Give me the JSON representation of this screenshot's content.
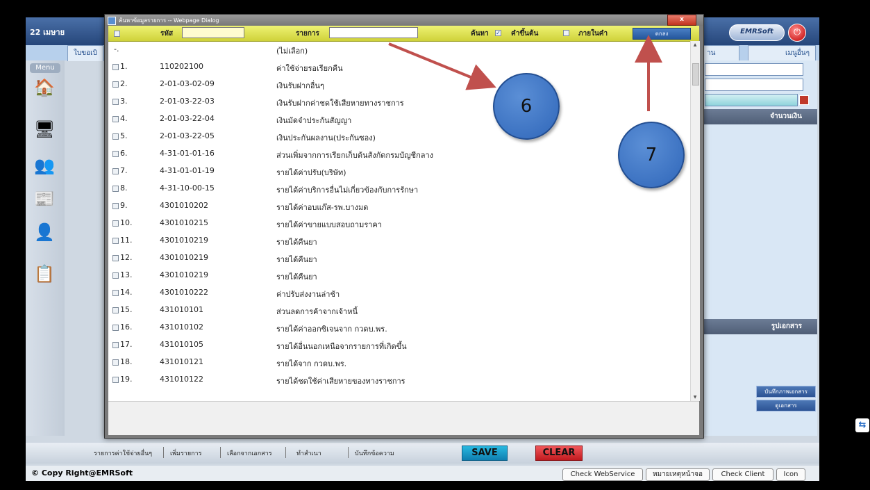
{
  "app": {
    "date_text": "22 เมษาย",
    "logo_text": "EMRSoft",
    "power_icon": "power-icon",
    "tabs": [
      {
        "label": "ใบขอเบิ"
      },
      {
        "label": "าน"
      },
      {
        "label": "เมนูอื่นๆ"
      }
    ],
    "menu_label": "Menu",
    "menu_icons": [
      "home-icon",
      "computer-key-icon",
      "users-icon",
      "documents-icon",
      "user-settings-icon",
      "clipboard-icon"
    ],
    "right_panel": {
      "amount_header": "จำนวนเงิน",
      "doc_header": "รูปเอกสาร",
      "btn_save_doc": "บันทึกภาพเอกสาร",
      "btn_view_doc": "ดูเอกสาร"
    },
    "bottom_bar": {
      "items": [
        "รายการค่าใช้จ่ายอื่นๆ",
        "เพิ่มรายการ",
        "เลือกจากเอกสาร",
        "ทำสำเนา",
        "บันทึกข้อความ"
      ],
      "save_label": "SAVE",
      "clear_label": "CLEAR"
    },
    "status_bar": {
      "copyright": "© Copy Right@EMRSoft",
      "buttons": [
        "Check WebService",
        "หมายเหตุหน้าจอ",
        "Check Client",
        "Icon"
      ]
    }
  },
  "dialog": {
    "title": "ค้นหาข้อมูลรายการ -- Webpage Dialog",
    "close_label": "x",
    "search": {
      "code_label": "รหัส",
      "code_value": "",
      "item_label": "รายการ",
      "item_value": "",
      "find_label": "ค้นหา",
      "find_checked": true,
      "prefix_label": "คำขึ้นต้น",
      "prefix_checked": false,
      "contains_label": "ภายในคำ",
      "ok_label": "ตกลง"
    },
    "rows": [
      {
        "num": "-.",
        "code": "",
        "name": "(ไม่เลือก)",
        "has_check": false
      },
      {
        "num": "1.",
        "code": "110202100",
        "name": "ค่าใช้จ่ายรอเรียกคืน",
        "has_check": true
      },
      {
        "num": "2.",
        "code": "2-01-03-02-09",
        "name": "เงินรับฝากอื่นๆ",
        "has_check": true
      },
      {
        "num": "3.",
        "code": "2-01-03-22-03",
        "name": "เงินรับฝากค่าชดใช้เสียหายทางราชการ",
        "has_check": true
      },
      {
        "num": "4.",
        "code": "2-01-03-22-04",
        "name": "เงินมัดจำประกันสัญญา",
        "has_check": true
      },
      {
        "num": "5.",
        "code": "2-01-03-22-05",
        "name": "เงินประกันผลงาน(ประกันซอง)",
        "has_check": true
      },
      {
        "num": "6.",
        "code": "4-31-01-01-16",
        "name": "ส่วนเพิ่มจากการเรียกเก็บต้นสังกัดกรมบัญชีกลาง",
        "has_check": true
      },
      {
        "num": "7.",
        "code": "4-31-01-01-19",
        "name": "รายได้ค่าปรับ(บริษัท)",
        "has_check": true
      },
      {
        "num": "8.",
        "code": "4-31-10-00-15",
        "name": "รายได้ค่าบริการอื่นไม่เกี่ยวข้องกับการรักษา",
        "has_check": true
      },
      {
        "num": "9.",
        "code": "4301010202",
        "name": "รายได้ค่าอบแก๊ส-รพ.บางมด",
        "has_check": true
      },
      {
        "num": "10.",
        "code": "4301010215",
        "name": "รายได้ค่าขายแบบสอบถามราคา",
        "has_check": true
      },
      {
        "num": "11.",
        "code": "4301010219",
        "name": "รายได้คืนยา",
        "has_check": true
      },
      {
        "num": "12.",
        "code": "4301010219",
        "name": "รายได้คืนยา",
        "has_check": true
      },
      {
        "num": "13.",
        "code": "4301010219",
        "name": "รายได้คืนยา",
        "has_check": true
      },
      {
        "num": "14.",
        "code": "4301010222",
        "name": "ค่าปรับส่งงานล่าช้า",
        "has_check": true
      },
      {
        "num": "15.",
        "code": "431010101",
        "name": "ส่วนลดการค้าจากเจ้าหนี้",
        "has_check": true
      },
      {
        "num": "16.",
        "code": "431010102",
        "name": "รายได้ค่าออกซิเจนจาก กวดบ.พร.",
        "has_check": true
      },
      {
        "num": "17.",
        "code": "431010105",
        "name": "รายได้อื่นนอกเหนือจากรายการที่เกิดขึ้น",
        "has_check": true
      },
      {
        "num": "18.",
        "code": "431010121",
        "name": "รายได้จาก กวดบ.พร.",
        "has_check": true
      },
      {
        "num": "19.",
        "code": "431010122",
        "name": "รายได้ชดใช้ค่าเสียหายของทางราชการ",
        "has_check": true
      }
    ]
  },
  "annotations": {
    "callout_6": "6",
    "callout_7": "7",
    "arrow_color": "#c0504d"
  }
}
